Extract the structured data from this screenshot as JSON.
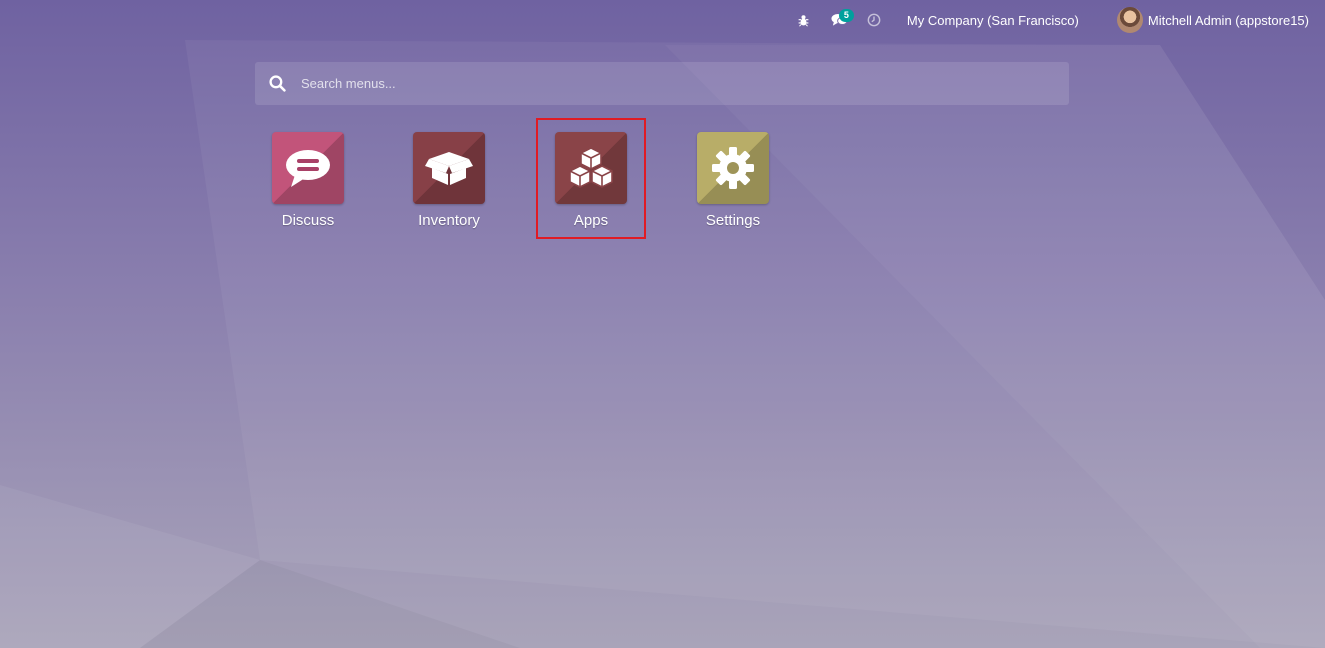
{
  "topbar": {
    "chat_badge": "5",
    "company": "My Company (San Francisco)",
    "user": "Mitchell Admin (appstore15)"
  },
  "search": {
    "placeholder": "Search menus..."
  },
  "apps": [
    {
      "label": "Discuss",
      "color": "#c2547a",
      "icon": "chat-icon"
    },
    {
      "label": "Inventory",
      "color": "#874047",
      "icon": "box-icon"
    },
    {
      "label": "Apps",
      "color": "#8a4448",
      "icon": "cubes-icon",
      "highlighted": true
    },
    {
      "label": "Settings",
      "color": "#b8ad68",
      "icon": "gear-icon"
    }
  ],
  "highlight_color": "#e01b24"
}
